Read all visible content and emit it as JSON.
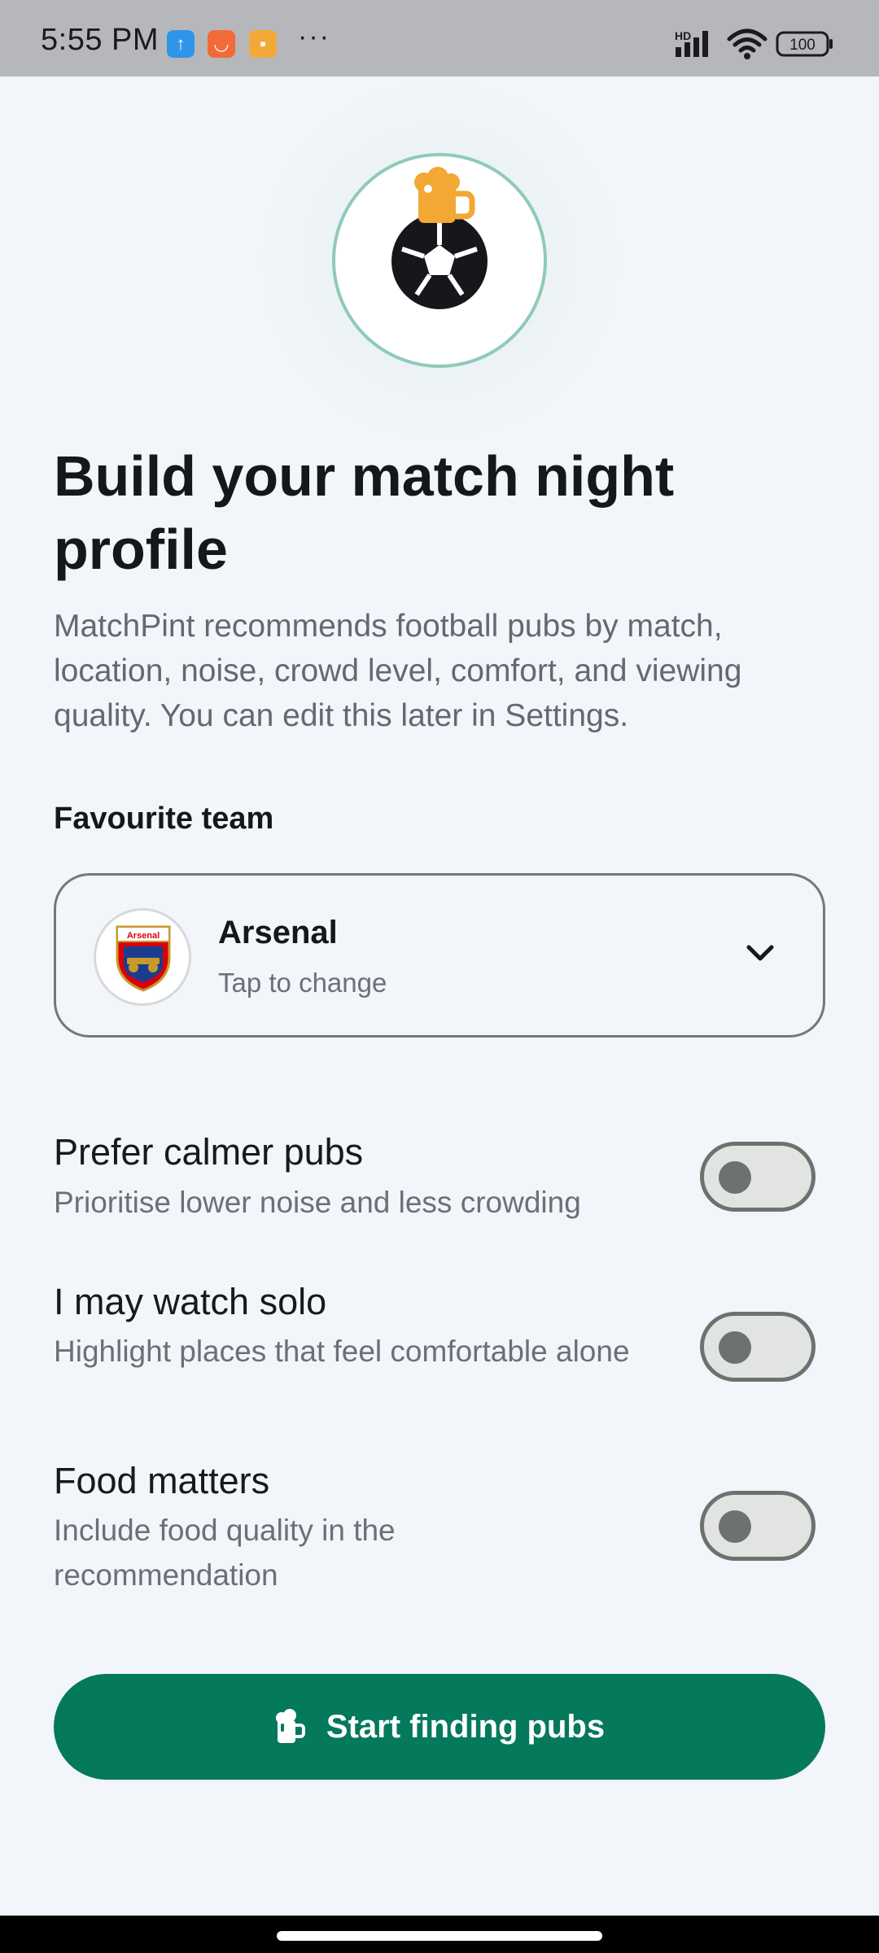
{
  "status_bar": {
    "time": "5:55 PM",
    "overflow": "···",
    "network": "HD",
    "battery": "100",
    "icons": [
      "app-notification-icon",
      "app-notification-icon",
      "app-notification-icon",
      "signal-icon",
      "wifi-icon",
      "battery-icon"
    ]
  },
  "hero": {
    "logo_icon": "ball-with-pint-icon",
    "colors": {
      "ring": "#8fcab9",
      "pint": "#f2a833",
      "ball": "#15171a"
    }
  },
  "header": {
    "title": "Build your match night profile",
    "subtitle": "MatchPint recommends football pubs by match, location, noise, crowd level, comfort, and viewing quality. You can edit this later in Settings."
  },
  "team_section": {
    "label": "Favourite team",
    "selected_team": "Arsenal",
    "hint": "Tap to change",
    "crest_text": "Arsenal",
    "chevron_icon": "chevron-down-icon"
  },
  "preferences": [
    {
      "title": "Prefer calmer pubs",
      "description": "Prioritise lower noise and less crowding",
      "enabled": false
    },
    {
      "title": "I may watch solo",
      "description": "Highlight places that feel comfortable alone",
      "enabled": false
    },
    {
      "title": "Food matters",
      "description": "Include food quality in the recommendation",
      "enabled": false
    }
  ],
  "cta": {
    "label": "Start finding pubs",
    "icon": "beer-mug-icon",
    "color": "#04795c"
  }
}
